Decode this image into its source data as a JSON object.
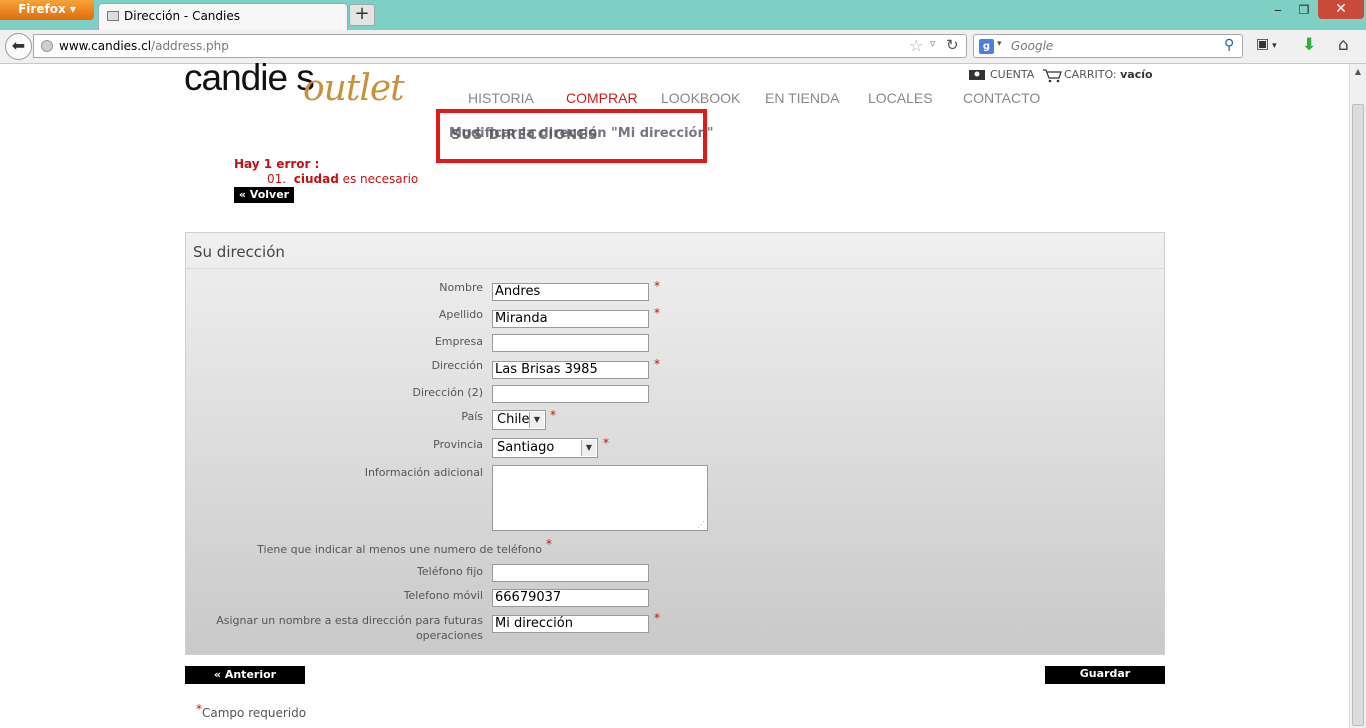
{
  "browser": {
    "app_button": "Firefox",
    "tab_title": "Dirección - Candies",
    "new_tab": "+",
    "window_controls": {
      "minimize": "‒",
      "restore": "❐",
      "close": "✕"
    },
    "url_host": "www.candies.cl",
    "url_path": "/address.php",
    "search_engine_icon": "g",
    "search_placeholder": "Google"
  },
  "site": {
    "logo_main": "candie s",
    "logo_sub": "outlet",
    "account": "CUENTA",
    "cart_label": "CARRITO:",
    "cart_value": "vacío",
    "menu": [
      "HISTORIA",
      "COMPRAR",
      "LOOKBOOK",
      "EN TIENDA",
      "LOCALES",
      "CONTACTO"
    ]
  },
  "subnav": {
    "overlap_a": "Modificar la dirección \"Mi dirección\"",
    "overlap_b": "SUS DIRECCIONES"
  },
  "errors": {
    "title": "Hay 1 error :",
    "item_number": "01.",
    "item_field": "ciudad",
    "item_text": "es necesario",
    "back": "« Volver"
  },
  "form": {
    "title": "Su dirección",
    "fields": {
      "nombre": {
        "label": "Nombre",
        "value": "Andres"
      },
      "apellido": {
        "label": "Apellido",
        "value": "Miranda"
      },
      "empresa": {
        "label": "Empresa",
        "value": ""
      },
      "direccion": {
        "label": "Dirección",
        "value": "Las Brisas 3985"
      },
      "direccion2": {
        "label": "Dirección (2)",
        "value": ""
      },
      "pais": {
        "label": "País",
        "value": "Chile"
      },
      "provincia": {
        "label": "Provincia",
        "value": "Santiago"
      },
      "info": {
        "label": "Información adicional",
        "value": ""
      },
      "phone_note": {
        "label": "Tiene que indicar al menos une numero de teléfono"
      },
      "tel_fijo": {
        "label": "Teléfono fijo",
        "value": ""
      },
      "tel_movil": {
        "label": "Telefono móvil",
        "value": "66679037"
      },
      "alias": {
        "label_line1": "Asignar un nombre a esta dirección para futuras",
        "label_line2": "operaciones",
        "value": "Mi dirección"
      }
    },
    "required_mark": "*",
    "prev_button": "« Anterior",
    "save_button": "Guardar",
    "required_note": "Campo requerido"
  },
  "colors": {
    "titlebar": "#7fd0c4",
    "accent_red": "#d01b1b",
    "highlight": "#de1a1a"
  }
}
